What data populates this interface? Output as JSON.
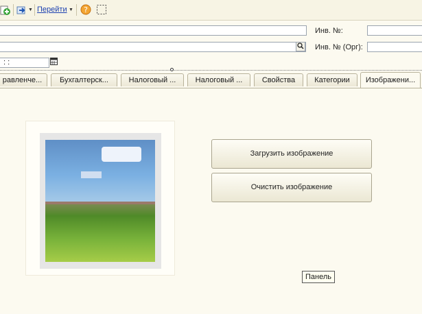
{
  "toolbar": {
    "goto_label": "Перейти",
    "icons": [
      "green-add-icon",
      "blue-arrow-icon",
      "help-icon",
      "select-frame-icon"
    ]
  },
  "fields": {
    "inv_label": "Инв. №:",
    "inv_org_label": "Инв. № (Орг):",
    "date_value": ": :"
  },
  "tabs": [
    {
      "label": "равленче..."
    },
    {
      "label": "Бухгалтерск..."
    },
    {
      "label": "Налоговый ..."
    },
    {
      "label": "Налоговый ..."
    },
    {
      "label": "Свойства"
    },
    {
      "label": "Категории"
    },
    {
      "label": "Изображени..."
    }
  ],
  "active_tab_index": 6,
  "image_panel": {
    "load_button": "Загрузить изображение",
    "clear_button": "Очистить изображение"
  },
  "tooltip": "Панель",
  "colors": {
    "background": "#fcfaf0",
    "link": "#1a3fb0"
  }
}
